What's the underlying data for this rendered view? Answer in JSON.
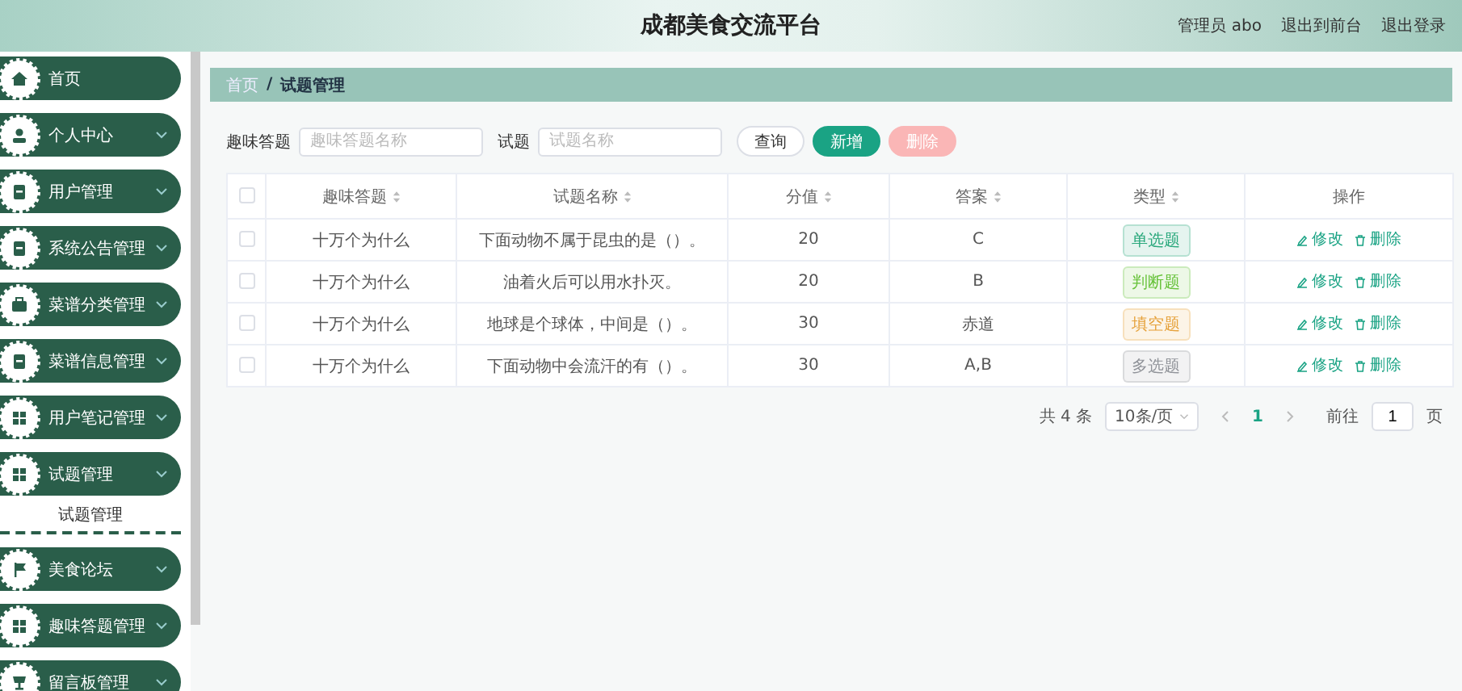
{
  "header": {
    "title": "成都美食交流平台",
    "user": "管理员 abo",
    "links": [
      "退出到前台",
      "退出登录"
    ]
  },
  "sidebar": {
    "items": [
      {
        "label": "首页",
        "kind": "link"
      },
      {
        "label": "个人中心",
        "kind": "menu"
      },
      {
        "label": "用户管理",
        "kind": "menu"
      },
      {
        "label": "系统公告管理",
        "kind": "menu"
      },
      {
        "label": "菜谱分类管理",
        "kind": "menu"
      },
      {
        "label": "菜谱信息管理",
        "kind": "menu"
      },
      {
        "label": "用户笔记管理",
        "kind": "menu"
      },
      {
        "label": "试题管理",
        "kind": "menu",
        "children": [
          {
            "label": "试题管理"
          }
        ]
      },
      {
        "label": "美食论坛",
        "kind": "menu"
      },
      {
        "label": "趣味答题管理",
        "kind": "menu"
      },
      {
        "label": "留言板管理",
        "kind": "menu"
      }
    ]
  },
  "breadcrumb": {
    "separator": "/",
    "items": [
      "首页",
      "试题管理"
    ]
  },
  "search": {
    "fields": [
      {
        "label": "趣味答题",
        "placeholder": "趣味答题名称"
      },
      {
        "label": "试题",
        "placeholder": "试题名称"
      }
    ],
    "buttons": [
      {
        "label": "查询",
        "kind": "default"
      },
      {
        "label": "新增",
        "kind": "primary"
      },
      {
        "label": "删除",
        "kind": "danger",
        "disabled": true
      }
    ]
  },
  "table": {
    "header_checked": false,
    "columns": [
      {
        "label": "趣味答题",
        "sortable": true
      },
      {
        "label": "试题名称",
        "sortable": true
      },
      {
        "label": "分值",
        "sortable": true
      },
      {
        "label": "答案",
        "sortable": true
      },
      {
        "label": "类型",
        "sortable": true
      },
      {
        "label": "操作",
        "sortable": false
      }
    ],
    "rows": [
      {
        "checked": false,
        "quiz": "十万个为什么",
        "question": "下面动物不属于昆虫的是（）。",
        "score": "20",
        "answer": "C",
        "type": {
          "label": "单选题",
          "color": "#2aa87c"
        },
        "actions": [
          "修改",
          "删除"
        ]
      },
      {
        "checked": false,
        "quiz": "十万个为什么",
        "question": "油着火后可以用水扑灭。",
        "score": "20",
        "answer": "B",
        "type": {
          "label": "判断题",
          "color": "#67c23a"
        },
        "actions": [
          "修改",
          "删除"
        ]
      },
      {
        "checked": false,
        "quiz": "十万个为什么",
        "question": "地球是个球体，中间是（）。",
        "score": "30",
        "answer": "赤道",
        "type": {
          "label": "填空题",
          "color": "#e6a23c"
        },
        "actions": [
          "修改",
          "删除"
        ]
      },
      {
        "checked": false,
        "quiz": "十万个为什么",
        "question": "下面动物中会流汗的有（）。",
        "score": "30",
        "answer": "A,B",
        "type": {
          "label": "多选题",
          "color": "#909399"
        },
        "actions": [
          "修改",
          "删除"
        ]
      }
    ]
  },
  "pagination": {
    "total": "共 4 条",
    "page_size": "10条/页",
    "pages": [
      {
        "label": "1",
        "selected": true
      }
    ],
    "goto_label": "前往",
    "goto_value": "1",
    "goto_suffix": "页"
  }
}
